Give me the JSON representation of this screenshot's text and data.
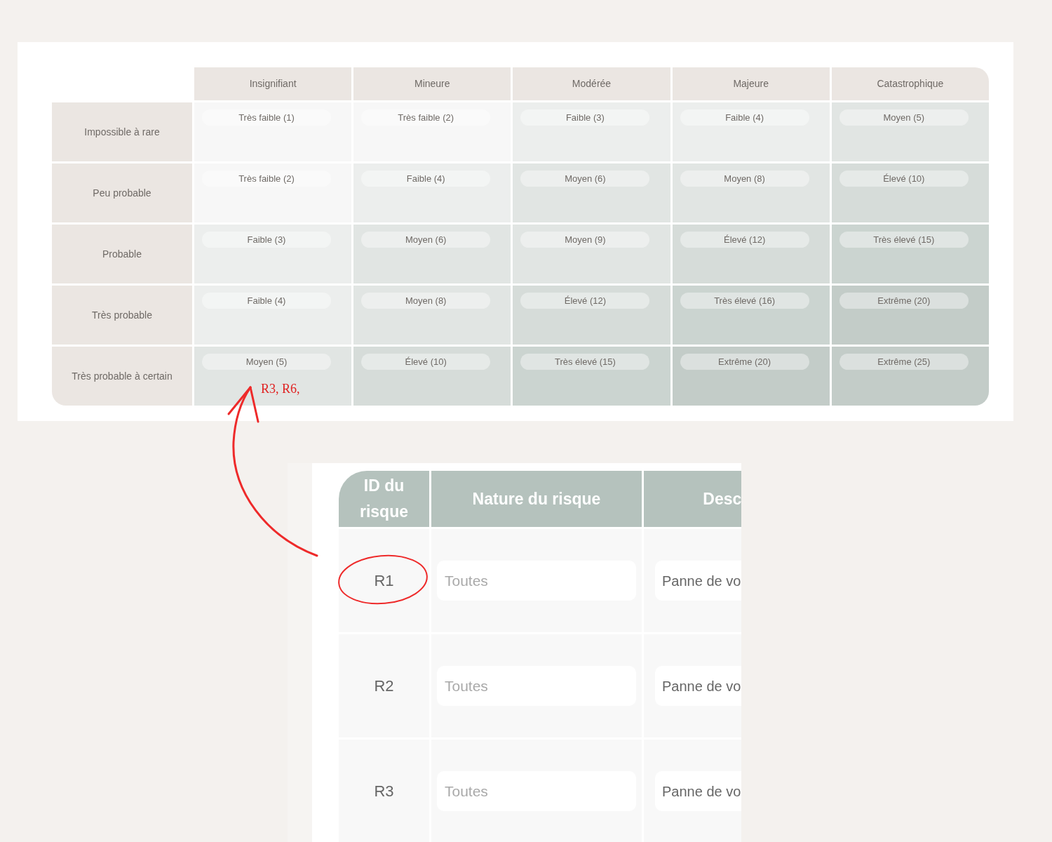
{
  "risk_matrix": {
    "columns": [
      "Insignifiant",
      "Mineure",
      "Modérée",
      "Majeure",
      "Catastrophique"
    ],
    "rows": [
      {
        "label": "Impossible à rare",
        "cells": [
          {
            "text": "Très faible (1)",
            "color": "#f7f7f7"
          },
          {
            "text": "Très faible (2)",
            "color": "#f7f7f7"
          },
          {
            "text": "Faible (3)",
            "color": "#eceeed"
          },
          {
            "text": "Faible (4)",
            "color": "#eceeed"
          },
          {
            "text": "Moyen (5)",
            "color": "#e1e5e3"
          }
        ]
      },
      {
        "label": "Peu probable",
        "cells": [
          {
            "text": "Très faible (2)",
            "color": "#f7f7f7"
          },
          {
            "text": "Faible (4)",
            "color": "#eceeed"
          },
          {
            "text": "Moyen (6)",
            "color": "#e1e5e3"
          },
          {
            "text": "Moyen (8)",
            "color": "#e1e5e3"
          },
          {
            "text": "Élevé (10)",
            "color": "#d6dcd9"
          }
        ]
      },
      {
        "label": "Probable",
        "cells": [
          {
            "text": "Faible (3)",
            "color": "#eceeed"
          },
          {
            "text": "Moyen (6)",
            "color": "#e1e5e3"
          },
          {
            "text": "Moyen (9)",
            "color": "#e1e5e3"
          },
          {
            "text": "Élevé (12)",
            "color": "#d6dcd9"
          },
          {
            "text": "Très élevé (15)",
            "color": "#cbd4d0"
          }
        ]
      },
      {
        "label": "Très probable",
        "cells": [
          {
            "text": "Faible (4)",
            "color": "#eceeed"
          },
          {
            "text": "Moyen (8)",
            "color": "#e1e5e3"
          },
          {
            "text": "Élevé (12)",
            "color": "#d6dcd9"
          },
          {
            "text": "Très élevé (16)",
            "color": "#cbd4d0"
          },
          {
            "text": "Extrême (20)",
            "color": "#c3ccc8"
          }
        ]
      },
      {
        "label": "Très probable à certain",
        "cells": [
          {
            "text": "Moyen (5)",
            "color": "#e1e5e3",
            "note": "R3, R6,"
          },
          {
            "text": "Élevé (10)",
            "color": "#d6dcd9"
          },
          {
            "text": "Très élevé (15)",
            "color": "#cbd4d0"
          },
          {
            "text": "Extrême (20)",
            "color": "#c3ccc8"
          },
          {
            "text": "Extrême (25)",
            "color": "#c3ccc8"
          }
        ]
      }
    ]
  },
  "risk_table": {
    "columns": [
      "ID du risque",
      "Nature du risque",
      "Desc"
    ],
    "rows": [
      {
        "id": "R1",
        "nature_placeholder": "Toutes",
        "description": "Panne de vo",
        "circled": true
      },
      {
        "id": "R2",
        "nature_placeholder": "Toutes",
        "description": "Panne de vo",
        "circled": false
      },
      {
        "id": "R3",
        "nature_placeholder": "Toutes",
        "description": "Panne de vo",
        "circled": false
      }
    ]
  }
}
